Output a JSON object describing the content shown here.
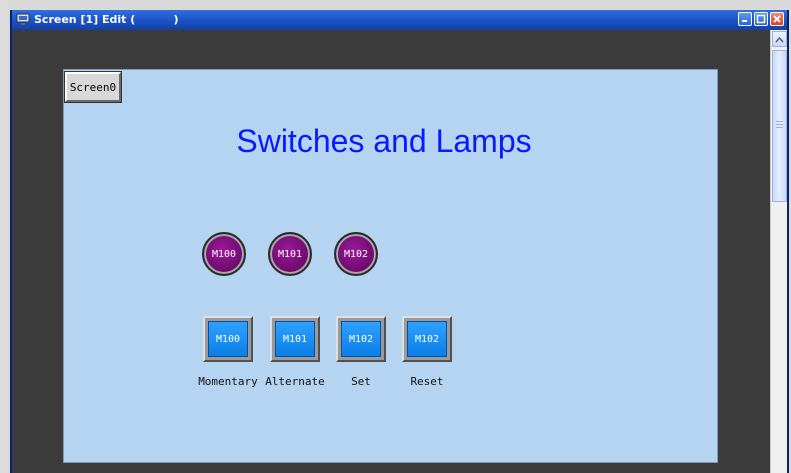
{
  "window": {
    "title": "Screen [1] Edit (          )",
    "title_bar_color": "#1a4fc4"
  },
  "screen_button": {
    "label": "Screen0"
  },
  "heading": "Switches and Lamps",
  "lamps": [
    {
      "label": "M100",
      "color": "#6a0a6a"
    },
    {
      "label": "M101",
      "color": "#6a0a6a"
    },
    {
      "label": "M102",
      "color": "#6a0a6a"
    }
  ],
  "switches": [
    {
      "label": "M100",
      "caption": "Momentary",
      "color": "#0b7fe6"
    },
    {
      "label": "M101",
      "caption": "Alternate",
      "color": "#0b7fe6"
    },
    {
      "label": "M102",
      "caption": "Set",
      "color": "#0b7fe6"
    },
    {
      "label": "M102",
      "caption": "Reset",
      "color": "#0b7fe6"
    }
  ],
  "canvas_color": "#b4d4f2",
  "icons": [
    "app-icon",
    "minimize-icon",
    "maximize-icon",
    "close-icon",
    "scroll-up-arrow-icon"
  ]
}
